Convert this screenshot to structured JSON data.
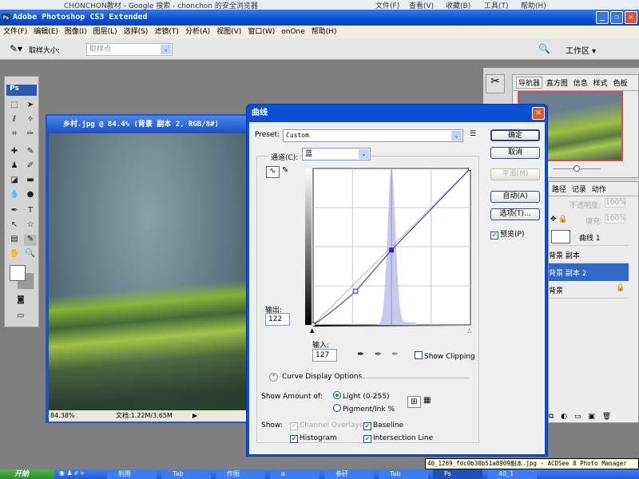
{
  "browser_bar": {
    "title": "CHONCHON教材 - Google 搜索 - chonchon 的安全浏览器",
    "menu": [
      "文件(F)",
      "查看(V)",
      "收藏(B)",
      "工具(T)",
      "帮助(H)"
    ]
  },
  "app": {
    "title": "Adobe Photoshop CS3 Extended",
    "logo": "Ps"
  },
  "menu": [
    "文件(F)",
    "编辑(E)",
    "图像(I)",
    "图层(L)",
    "选择(S)",
    "滤镜(T)",
    "分析(A)",
    "视图(V)",
    "窗口(W)",
    "onOne",
    "帮助(H)"
  ],
  "options": {
    "sample_label": "取样大小:",
    "sample_value": "取样点",
    "workspace": "工作区 ▾"
  },
  "document": {
    "title": "乡村.jpg @ 84.4% (背景 副本 2, RGB/8#)",
    "zoom": "84.38%",
    "doc_size": "文档:1.22M/3.65M"
  },
  "curves": {
    "title": "曲线",
    "preset_label": "Preset:",
    "preset_value": "Custom",
    "channel_label": "通道(C):",
    "channel_value": "蓝",
    "output_label": "输出:",
    "output_value": "122",
    "input_label": "输入:",
    "input_value": "127",
    "show_clipping": "Show Clipping",
    "show_clipping_checked": false,
    "display_options": "Curve Display Options",
    "show_amount_label": "Show Amount of:",
    "light": "Light  (0-255)",
    "light_selected": true,
    "pigment": "Pigment/Ink %",
    "show_label": "Show:",
    "channel_overlays": "Channel Overlays",
    "baseline": "Baseline",
    "histogram": "Histogram",
    "intersection_line": "Intersection Line",
    "buttons": {
      "ok": "确定",
      "cancel": "取消",
      "smooth": "平滑(M)",
      "auto": "自动(A)",
      "options": "选项(T)..."
    },
    "preview": "预览(P)",
    "preview_checked": true,
    "curve_points": [
      [
        0,
        0
      ],
      [
        69,
        55
      ],
      [
        127,
        122
      ],
      [
        255,
        255
      ]
    ],
    "histogram_peak_input": 127,
    "curve_color": "#2a2aa0",
    "histogram_color": "#c8c8f0"
  },
  "navigator": {
    "tabs": [
      "导航器",
      "直方图",
      "信息",
      "样式",
      "色板"
    ]
  },
  "layers": {
    "tabs": [
      "路径",
      "记录",
      "动作"
    ],
    "opacity_label": "不透明度:",
    "opacity": "100%",
    "fill_label": "填充:",
    "fill": "100%",
    "items": [
      {
        "name": "曲线 1",
        "selected": false
      },
      {
        "name": "背景 副本",
        "selected": false
      },
      {
        "name": "背景 副本 2",
        "selected": true
      },
      {
        "name": "背景",
        "selected": false,
        "locked": true
      }
    ]
  },
  "tooltip": "40_1269_fdc0b30b51a8909副本.jpg - ACDSee 8 Photo Manager",
  "taskbar": {
    "start": "开始",
    "tasks": [
      "利用",
      "Tab",
      "作图",
      "a",
      "参矸",
      "Tab",
      "Ps",
      "40_1"
    ]
  }
}
